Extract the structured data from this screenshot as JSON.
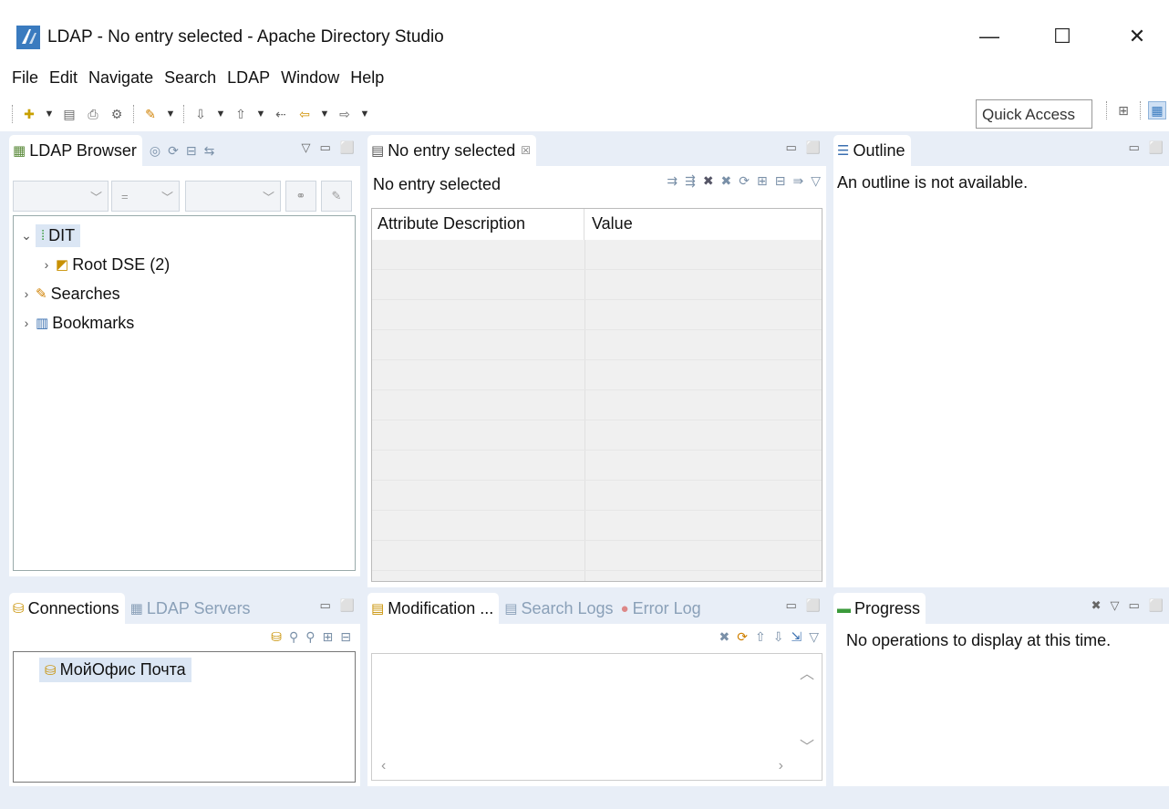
{
  "window": {
    "title": "LDAP - No entry selected - Apache Directory Studio",
    "minimize": "—",
    "maximize": "☐",
    "close": "✕"
  },
  "menu": [
    "File",
    "Edit",
    "Navigate",
    "Search",
    "LDAP",
    "Window",
    "Help"
  ],
  "toolbar": {
    "quick_access": "Quick Access"
  },
  "ldap_browser": {
    "tab_label": "LDAP Browser",
    "filter_operator": "=",
    "tree": [
      {
        "label": "DIT",
        "expanded": true
      },
      {
        "label": "Root DSE (2)"
      },
      {
        "label": "Searches"
      },
      {
        "label": "Bookmarks"
      }
    ]
  },
  "entry_editor": {
    "tab_label": "No entry selected",
    "tab_close": "☒",
    "header": "No entry selected",
    "columns": [
      "Attribute Description",
      "Value"
    ]
  },
  "outline": {
    "tab_label": "Outline",
    "message": "An outline is not available."
  },
  "connections": {
    "tab_label": "Connections",
    "servers_tab": "LDAP Servers",
    "items": [
      "МойОфис Почта"
    ]
  },
  "logs": {
    "tab_modification": "Modification ...",
    "tab_search_logs": "Search Logs",
    "tab_error_log": "Error Log"
  },
  "progress": {
    "tab_label": "Progress",
    "message": "No operations to display at this time."
  },
  "colors": {
    "workbench_bg": "#e8eef7",
    "selection": "#dbe6f4"
  }
}
